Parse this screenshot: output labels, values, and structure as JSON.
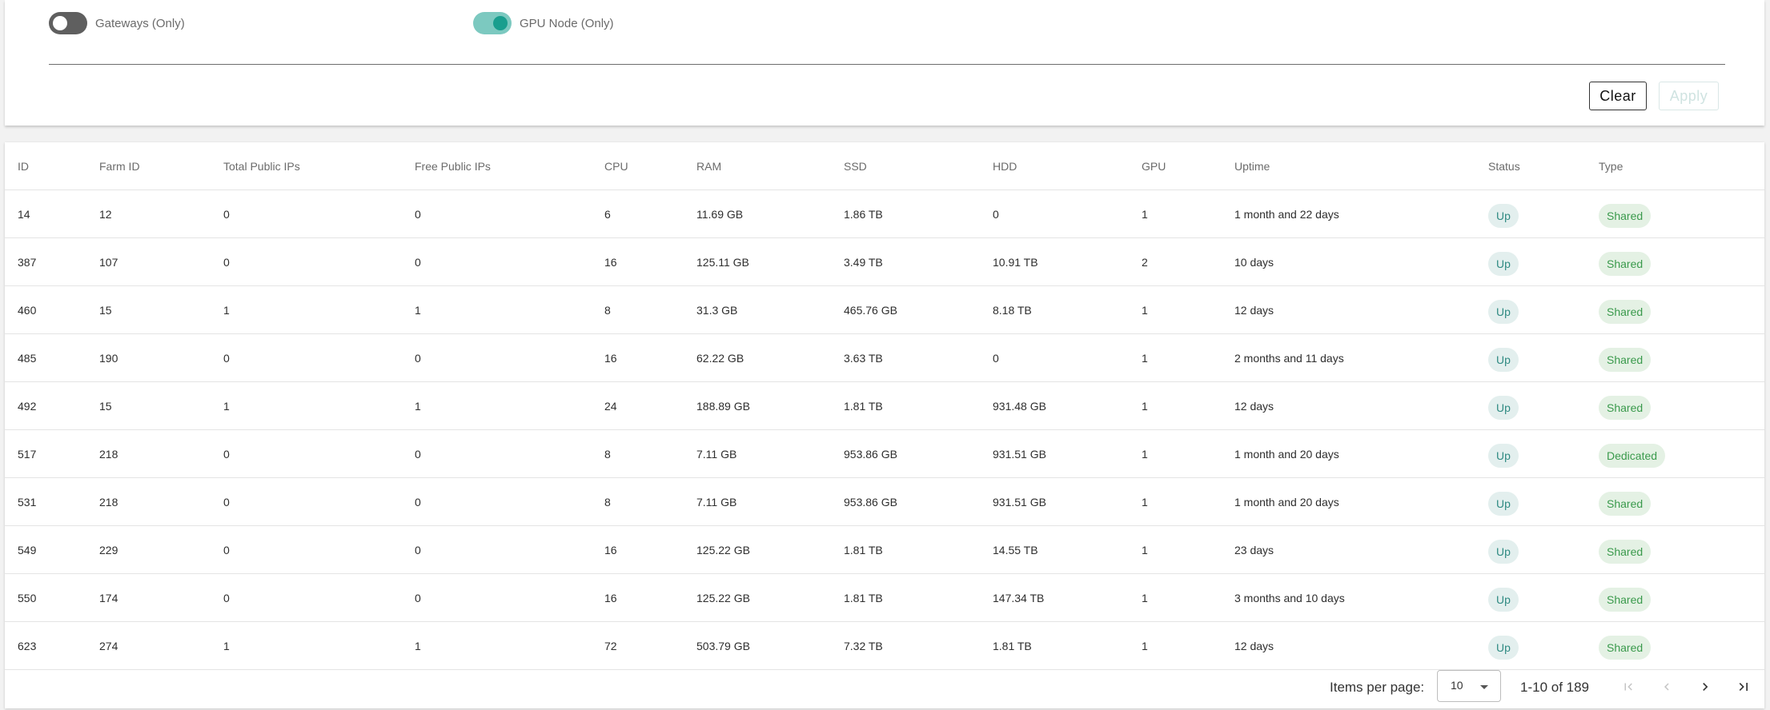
{
  "filters": {
    "gateways_label": "Gateways (Only)",
    "gateways_on": false,
    "gpu_label": "GPU Node (Only)",
    "gpu_on": true,
    "clear_label": "Clear",
    "apply_label": "Apply"
  },
  "table": {
    "columns": [
      "ID",
      "Farm ID",
      "Total Public IPs",
      "Free Public IPs",
      "CPU",
      "RAM",
      "SSD",
      "HDD",
      "GPU",
      "Uptime",
      "Status",
      "Type"
    ],
    "rows": [
      [
        "14",
        "12",
        "0",
        "0",
        "6",
        "11.69 GB",
        "1.86 TB",
        "0",
        "1",
        "1 month and 22 days",
        "Up",
        "Shared"
      ],
      [
        "387",
        "107",
        "0",
        "0",
        "16",
        "125.11 GB",
        "3.49 TB",
        "10.91 TB",
        "2",
        "10 days",
        "Up",
        "Shared"
      ],
      [
        "460",
        "15",
        "1",
        "1",
        "8",
        "31.3 GB",
        "465.76 GB",
        "8.18 TB",
        "1",
        "12 days",
        "Up",
        "Shared"
      ],
      [
        "485",
        "190",
        "0",
        "0",
        "16",
        "62.22 GB",
        "3.63 TB",
        "0",
        "1",
        "2 months and 11 days",
        "Up",
        "Shared"
      ],
      [
        "492",
        "15",
        "1",
        "1",
        "24",
        "188.89 GB",
        "1.81 TB",
        "931.48 GB",
        "1",
        "12 days",
        "Up",
        "Shared"
      ],
      [
        "517",
        "218",
        "0",
        "0",
        "8",
        "7.11 GB",
        "953.86 GB",
        "931.51 GB",
        "1",
        "1 month and 20 days",
        "Up",
        "Dedicated"
      ],
      [
        "531",
        "218",
        "0",
        "0",
        "8",
        "7.11 GB",
        "953.86 GB",
        "931.51 GB",
        "1",
        "1 month and 20 days",
        "Up",
        "Shared"
      ],
      [
        "549",
        "229",
        "0",
        "0",
        "16",
        "125.22 GB",
        "1.81 TB",
        "14.55 TB",
        "1",
        "23 days",
        "Up",
        "Shared"
      ],
      [
        "550",
        "174",
        "0",
        "0",
        "16",
        "125.22 GB",
        "1.81 TB",
        "147.34 TB",
        "1",
        "3 months and 10 days",
        "Up",
        "Shared"
      ],
      [
        "623",
        "274",
        "1",
        "1",
        "72",
        "503.79 GB",
        "7.32 TB",
        "1.81 TB",
        "1",
        "12 days",
        "Up",
        "Shared"
      ]
    ]
  },
  "pagination": {
    "items_per_page_label": "Items per page:",
    "items_per_page_value": "10",
    "range_text": "1-10 of 189",
    "icons": [
      "first-page-icon",
      "previous-page-icon",
      "next-page-icon",
      "last-page-icon"
    ]
  },
  "colors": {
    "accent": "#199e8e",
    "status_chip_bg": "#e3efee",
    "type_chip_bg": "#e4f1e4"
  }
}
